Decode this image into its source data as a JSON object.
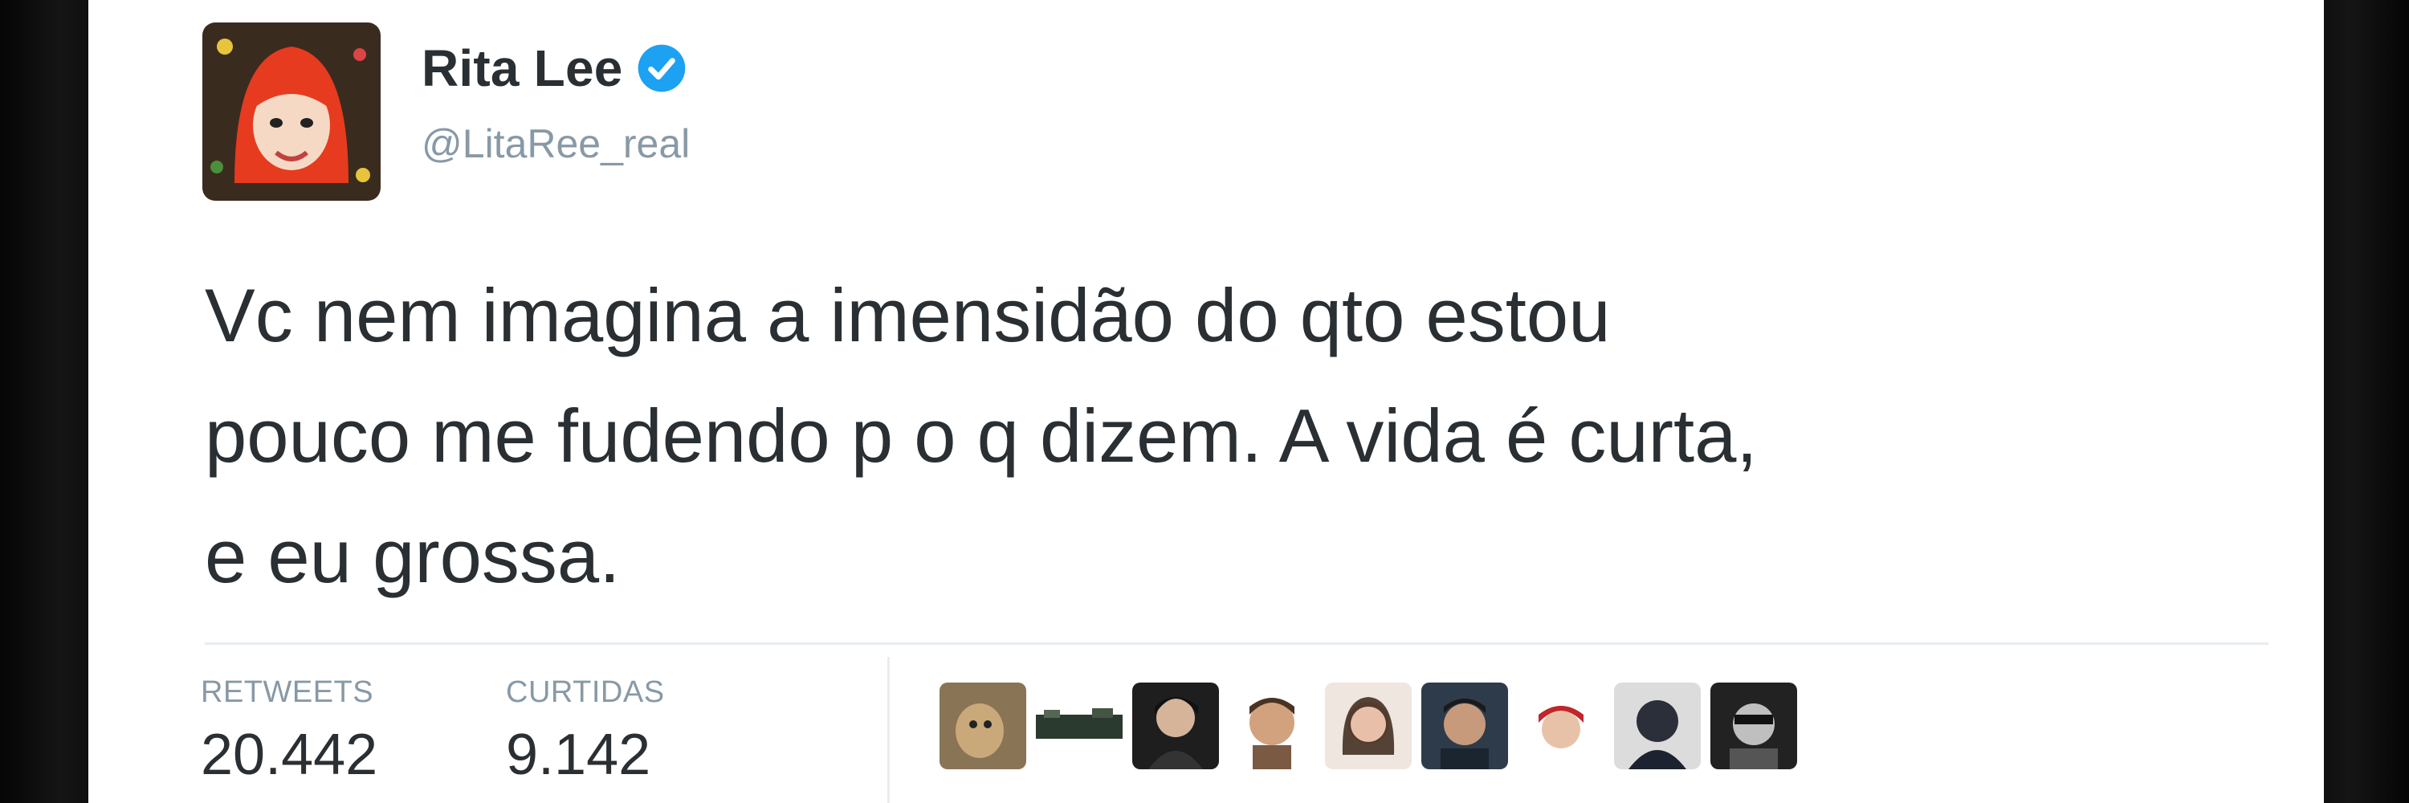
{
  "tweet": {
    "author_name": "Rita Lee",
    "handle": "@LitaRee_real",
    "verified_icon": "verified-badge-icon",
    "text_lines": [
      "Vc nem imagina a imensidão do qto estou",
      "pouco me fudendo p o q dizem. A vida é curta,",
      "e eu grossa."
    ]
  },
  "stats": {
    "retweets_label": "RETWEETS",
    "retweets_value": "20.442",
    "likes_label": "CURTIDAS",
    "likes_value": "9.142"
  },
  "likers": {
    "count": 10,
    "icon": "avatar-icon"
  },
  "colors": {
    "card_background": "#ffffff",
    "text_primary": "#292f33",
    "text_secondary": "#8899a6",
    "verified_blue": "#1da1f2",
    "avatar_hair": "#e63b1f",
    "background": "#0b0b0b"
  }
}
